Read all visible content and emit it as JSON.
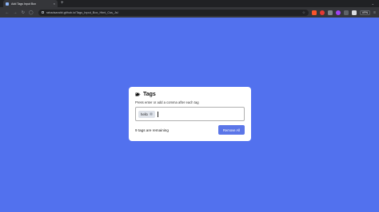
{
  "browser": {
    "tab_title": "Add Tags Input Box",
    "tab_close": "×",
    "new_tab": "+",
    "tab_dropdown": "⌄",
    "url": "rahadsaraikt.github.io/Tags_Input_Box_Html_Css_Js/",
    "vpn_label": "VPN"
  },
  "card": {
    "title": "Tags",
    "hint": "Press enter or add a comma after each tag",
    "tags": [
      "hello"
    ],
    "tag_remove_glyph": "×",
    "input_value": "",
    "remaining_text": "9 tags are remaining",
    "remove_all_label": "Remove All"
  },
  "colors": {
    "background": "#5271ee",
    "button": "#5b76e8",
    "card": "#ffffff"
  }
}
